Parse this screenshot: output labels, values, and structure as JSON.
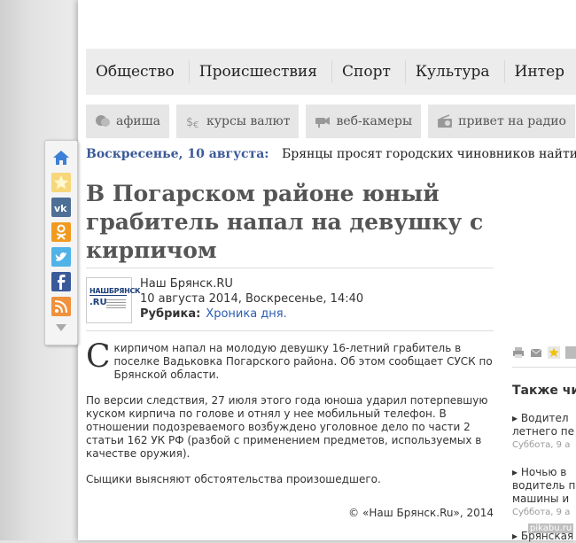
{
  "nav": {
    "main": [
      "Общество",
      "Происшествия",
      "Спорт",
      "Культура",
      "Интер"
    ],
    "sub": [
      {
        "label": "афиша",
        "icon": "theater-masks-icon"
      },
      {
        "label": "курсы валют",
        "icon": "currency-icon"
      },
      {
        "label": "веб-камеры",
        "icon": "camera-icon"
      },
      {
        "label": "привет на радио",
        "icon": "radio-icon"
      }
    ]
  },
  "ticker": {
    "date": "Воскресенье, 10 августа:",
    "text": "Брянцы просят городских чиновников найти"
  },
  "article": {
    "title": "В Погарском районе юный грабитель напал на девушку с кирпичом",
    "source": "Наш Брянск.RU",
    "datetime": "10 августа 2014, Воскресенье, 14:40",
    "rubric_label": "Рубрика:",
    "rubric_value": "Хроника дня.",
    "logo_line1": "НАШБРЯНСК",
    "logo_line2": ".RU",
    "dropcap": "С",
    "p1": "кирпичом напал на молодую девушку 16-летний грабитель в поселке Вадьковка Погарского района. Об этом сообщает СУСК по Брянской области.",
    "p2": "По версии следствия, 27 июля этого года юноша ударил потерпевшую куском кирпича по голове и отнял у нее мобильный телефон. В отношении подозреваемого возбуждено уголовное дело по части 2 статьи 162 УК РФ (разбой с применением предметов, используемых в качестве оружия).",
    "p3": "Сыщики выясняют обстоятельства произошедшего.",
    "copyright": "© «Наш Брянск.Ru», 2014"
  },
  "sidebar": {
    "heading": "Также чи",
    "items": [
      {
        "text1": "▸ Водител",
        "text2": "летнего пе",
        "date": "Суббота, 9 а"
      },
      {
        "text1": "▸ Ночью в",
        "text2": "водитель п",
        "text3": "машины и",
        "date": "Суббота, 9 а"
      },
      {
        "text1": "▸ Брянская"
      }
    ]
  },
  "share_icons": [
    "home-icon",
    "star-icon",
    "vk-icon",
    "odnoklassniki-icon",
    "twitter-icon",
    "facebook-icon",
    "rss-icon",
    "chevron-down-icon"
  ],
  "watermark": "pikabu.ru",
  "colors": {
    "accent": "#3b5998",
    "link": "#2a5db0",
    "title": "#555555"
  }
}
